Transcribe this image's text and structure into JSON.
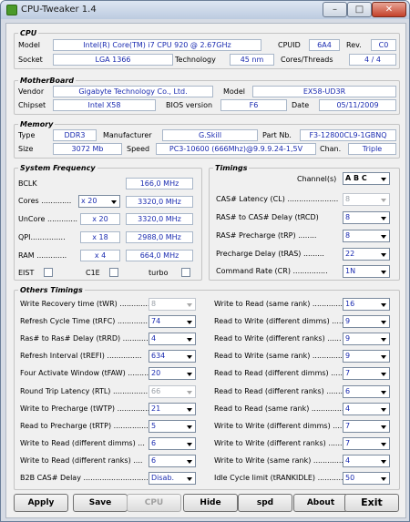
{
  "window": {
    "title": "CPU-Tweaker 1.4"
  },
  "cpu": {
    "title": "CPU",
    "model_label": "Model",
    "model_value": "Intel(R) Core(TM) i7 CPU        920  @ 2.67GHz",
    "cpuid_label": "CPUID",
    "cpuid_value": "6A4",
    "rev_label": "Rev.",
    "rev_value": "C0",
    "socket_label": "Socket",
    "socket_value": "LGA 1366",
    "tech_label": "Technology",
    "tech_value": "45 nm",
    "ct_label": "Cores/Threads",
    "ct_value": "4 / 4"
  },
  "motherboard": {
    "title": "MotherBoard",
    "vendor_label": "Vendor",
    "vendor_value": "Gigabyte Technology Co., Ltd.",
    "model_label": "Model",
    "model_value": "EX58-UD3R",
    "chipset_label": "Chipset",
    "chipset_value": "Intel X58",
    "bios_label": "BIOS version",
    "bios_value": "F6",
    "date_label": "Date",
    "date_value": "05/11/2009"
  },
  "memory": {
    "title": "Memory",
    "type_label": "Type",
    "type_value": "DDR3",
    "manu_label": "Manufacturer",
    "manu_value": "G.Skill",
    "part_label": "Part Nb.",
    "part_value": "F3-12800CL9-1GBNQ",
    "size_label": "Size",
    "size_value": "3072 Mb",
    "speed_label": "Speed",
    "speed_value": "PC3-10600 (666Mhz)@9.9.9.24-1,5V",
    "chan_label": "Chan.",
    "chan_value": "Triple"
  },
  "sysfreq": {
    "title": "System Frequency",
    "bclk_label": "BCLK",
    "bclk_value": "166,0 MHz",
    "cores_label": "Cores .............",
    "cores_mult": "x 20",
    "cores_value": "3320,0 MHz",
    "uncore_label": "UnCore .............",
    "uncore_mult": "x 20",
    "uncore_value": "3320,0 MHz",
    "qpi_label": "QPI...............",
    "qpi_mult": "x 18",
    "qpi_value": "2988,0 MHz",
    "ram_label": "RAM .............",
    "ram_mult": "x 4",
    "ram_value": "664,0 MHz",
    "eist_label": "EIST",
    "c1e_label": "C1E",
    "turbo_label": "turbo"
  },
  "timings": {
    "title": "Timings",
    "channels_label": "Channel(s)",
    "channels_value": "A B C",
    "cl_label": "CAS# Latency (CL) ......................",
    "cl_value": "8",
    "trcd_label": "RAS# to CAS# Delay (tRCD)",
    "trcd_value": "8",
    "trp_label": "RAS# Precharge (tRP) ........",
    "trp_value": "8",
    "tras_label": "Precharge Delay (tRAS) .........",
    "tras_value": "22",
    "cr_label": "Command Rate (CR) ...............",
    "cr_value": "1N"
  },
  "others": {
    "title": "Others Timings",
    "left": [
      {
        "label": "Write Recovery time (tWR) ................",
        "value": "8",
        "disabled": "true"
      },
      {
        "label": "Refresh Cycle Time (tRFC) .............",
        "value": "74",
        "disabled": "false"
      },
      {
        "label": "Ras# to Ras# Delay (tRRD) .............",
        "value": "4",
        "disabled": "false"
      },
      {
        "label": "Refresh Interval (tREFI) ...............",
        "value": "634",
        "disabled": "false"
      },
      {
        "label": "Four Activate Window (tFAW) ...........",
        "value": "20",
        "disabled": "false"
      },
      {
        "label": "Round Trip Latency (RTL) .................",
        "value": "66",
        "disabled": "true"
      },
      {
        "label": "Write to Precharge (tWTP) ...............",
        "value": "21",
        "disabled": "false"
      },
      {
        "label": "Read to Precharge (tRTP) ...............",
        "value": "5",
        "disabled": "false"
      },
      {
        "label": "Write to Read (different dimms) ...",
        "value": "6",
        "disabled": "false"
      },
      {
        "label": "Write to Read (different ranks) ....",
        "value": "6",
        "disabled": "false"
      },
      {
        "label": "B2B CAS# Delay ..............................",
        "value": "Disab.",
        "disabled": "false"
      }
    ],
    "right": [
      {
        "label": "Write to Read (same rank) ..............",
        "value": "16",
        "disabled": "false"
      },
      {
        "label": "Read to Write (different dimms) .....",
        "value": "9",
        "disabled": "false"
      },
      {
        "label": "Read to Write (different ranks) ......",
        "value": "9",
        "disabled": "false"
      },
      {
        "label": "Read to Write (same rank) ................",
        "value": "9",
        "disabled": "false"
      },
      {
        "label": "Read to Read (different dimms) ......",
        "value": "7",
        "disabled": "false"
      },
      {
        "label": "Read to Read (different ranks) .......",
        "value": "6",
        "disabled": "false"
      },
      {
        "label": "Read to Read (same rank) .................",
        "value": "4",
        "disabled": "false"
      },
      {
        "label": "Write to Write (different dimms) .....",
        "value": "7",
        "disabled": "false"
      },
      {
        "label": "Write to Write (different ranks) ......",
        "value": "7",
        "disabled": "false"
      },
      {
        "label": "Write to Write (same rank) ...............",
        "value": "4",
        "disabled": "false"
      },
      {
        "label": "Idle Cycle limit (tRANKIDLE) ...........",
        "value": "50",
        "disabled": "false"
      }
    ]
  },
  "buttons": {
    "apply": "Apply",
    "save": "Save",
    "cpu": "CPU",
    "hide": "Hide",
    "spd": "spd",
    "about": "About",
    "exit": "Exit"
  }
}
